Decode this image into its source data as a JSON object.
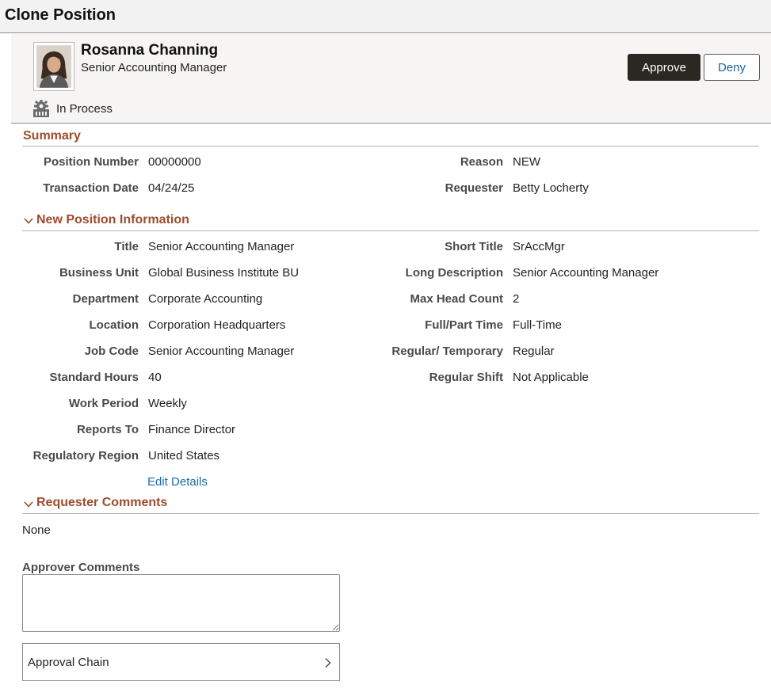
{
  "page": {
    "title": "Clone Position"
  },
  "employee": {
    "name": "Rosanna Channing",
    "job_title": "Senior Accounting Manager",
    "status": "In Process"
  },
  "actions": {
    "approve_label": "Approve",
    "deny_label": "Deny"
  },
  "summary": {
    "title": "Summary",
    "fields": {
      "position_number": {
        "label": "Position Number",
        "value": "00000000"
      },
      "transaction_date": {
        "label": "Transaction Date",
        "value": "04/24/25"
      },
      "reason": {
        "label": "Reason",
        "value": "NEW"
      },
      "requester": {
        "label": "Requester",
        "value": "Betty Locherty"
      }
    }
  },
  "new_position": {
    "title": "New Position Information",
    "left": [
      {
        "label": "Title",
        "value": "Senior Accounting Manager"
      },
      {
        "label": "Business Unit",
        "value": "Global Business Institute BU"
      },
      {
        "label": "Department",
        "value": "Corporate Accounting"
      },
      {
        "label": "Location",
        "value": "Corporation Headquarters"
      },
      {
        "label": "Job Code",
        "value": "Senior Accounting Manager"
      },
      {
        "label": "Standard Hours",
        "value": "40"
      },
      {
        "label": "Work Period",
        "value": "Weekly"
      },
      {
        "label": "Reports To",
        "value": "Finance Director"
      },
      {
        "label": "Regulatory Region",
        "value": "United States"
      }
    ],
    "right": [
      {
        "label": "Short Title",
        "value": "SrAccMgr"
      },
      {
        "label": "Long Description",
        "value": "Senior Accounting Manager"
      },
      {
        "label": "Max Head Count",
        "value": "2"
      },
      {
        "label": "Full/Part Time",
        "value": "Full-Time"
      },
      {
        "label": "Regular/ Temporary",
        "value": "Regular"
      },
      {
        "label": "Regular Shift",
        "value": "Not Applicable"
      }
    ],
    "edit_link": "Edit Details"
  },
  "requester_comments": {
    "title": "Requester Comments",
    "text": "None"
  },
  "approver_comments": {
    "label": "Approver Comments",
    "value": ""
  },
  "approval_chain": {
    "label": "Approval Chain"
  },
  "colors": {
    "section_title": "#9c4d2d",
    "link": "#1a6fa6",
    "approve_bg": "#2b2723"
  }
}
